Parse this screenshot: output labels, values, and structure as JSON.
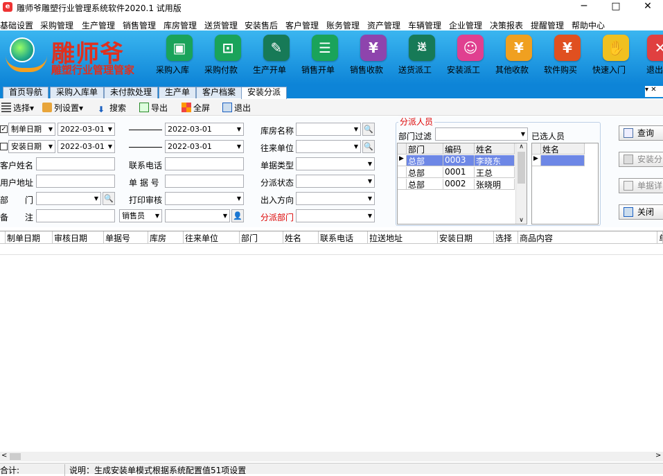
{
  "window": {
    "title": "雕师爷雕塑行业管理系统软件2020.1 试用版",
    "app_icon": "app-logo-icon",
    "minimize": "─",
    "maximize": "□",
    "close": "✕"
  },
  "menubar": [
    "基础设置",
    "采购管理",
    "生产管理",
    "销售管理",
    "库房管理",
    "送货管理",
    "安装售后",
    "客户管理",
    "账务管理",
    "资产管理",
    "车辆管理",
    "企业管理",
    "决策报表",
    "提醒管理",
    "帮助中心"
  ],
  "logo": {
    "title": "雕师爷",
    "subtitle": "雕塑行业管理管家"
  },
  "toolbar_buttons": [
    {
      "label": "采购入库",
      "icon": "folder-icon",
      "color": "#1aa35a"
    },
    {
      "label": "采购付款",
      "icon": "payment-icon",
      "color": "#1aa35a"
    },
    {
      "label": "生产开单",
      "icon": "document-edit-icon",
      "color": "#177a57"
    },
    {
      "label": "销售开单",
      "icon": "cart-icon",
      "color": "#1aa35a"
    },
    {
      "label": "销售收款",
      "icon": "receipt-icon",
      "color": "#8e44ad"
    },
    {
      "label": "送货派工",
      "icon": "truck-icon",
      "color": "#177a57"
    },
    {
      "label": "安装派工",
      "icon": "people-icon",
      "color": "#e04090"
    },
    {
      "label": "其他收款",
      "icon": "money-bag-icon",
      "color": "#f0a020"
    },
    {
      "label": "软件购买",
      "icon": "purchase-icon",
      "color": "#e05020"
    },
    {
      "label": "快速入门",
      "icon": "hand-icon",
      "color": "#f0c020"
    },
    {
      "label": "退出",
      "icon": "exit-icon",
      "color": "#e04040"
    }
  ],
  "tabs": [
    "首页导航",
    "采购入库单",
    "未付款处理",
    "生产单",
    "客户档案",
    "安装分派"
  ],
  "active_tab": "安装分派",
  "tab_controls": "▾ ✕",
  "subtoolbar": {
    "select": "选择▾",
    "columns": "列设置▾",
    "search": "搜索",
    "export": "导出",
    "fullscreen": "全屏",
    "exit": "退出"
  },
  "filters": {
    "date1_type": "制单日期",
    "date1_from": "2022-03-01",
    "date1_to": "2022-03-01",
    "date2_type": "安装日期",
    "date2_from": "2022-03-01",
    "date2_to": "2022-03-01",
    "customer_name": "客户姓名",
    "phone": "联系电话",
    "address": "用户地址",
    "doc_no": "单 据 号",
    "dept": "部　　门",
    "print_audit": "打印审核",
    "remark": "备　　注",
    "salesman": "销售员",
    "warehouse": "库房名称",
    "partner": "往来单位",
    "doc_type": "单据类型",
    "assign_status": "分派状态",
    "direction": "出入方向",
    "assign_dept": "分派部门"
  },
  "assign_panel": {
    "legend": "分派人员",
    "dept_filter": "部门过滤",
    "selected_label": "已选人员",
    "columns": [
      "部门",
      "编码",
      "姓名"
    ],
    "rows": [
      {
        "dept": "总部",
        "code": "0003",
        "name": "李晓东"
      },
      {
        "dept": "总部",
        "code": "0001",
        "name": "王总"
      },
      {
        "dept": "总部",
        "code": "0002",
        "name": "张晓明"
      }
    ],
    "selected_columns": [
      "姓名"
    ]
  },
  "actions": {
    "query": "查询",
    "install": "安装分",
    "detail": "单据详",
    "close": "关闭"
  },
  "main_columns": [
    "制单日期",
    "审核日期",
    "单据号",
    "库房",
    "往来单位",
    "部门",
    "姓名",
    "联系电话",
    "拉送地址",
    "安装日期",
    "选择",
    "商品内容",
    "单"
  ],
  "status": {
    "total": "合计:",
    "note": "说明：生成安装单模式根据系统配置值51项设置"
  }
}
